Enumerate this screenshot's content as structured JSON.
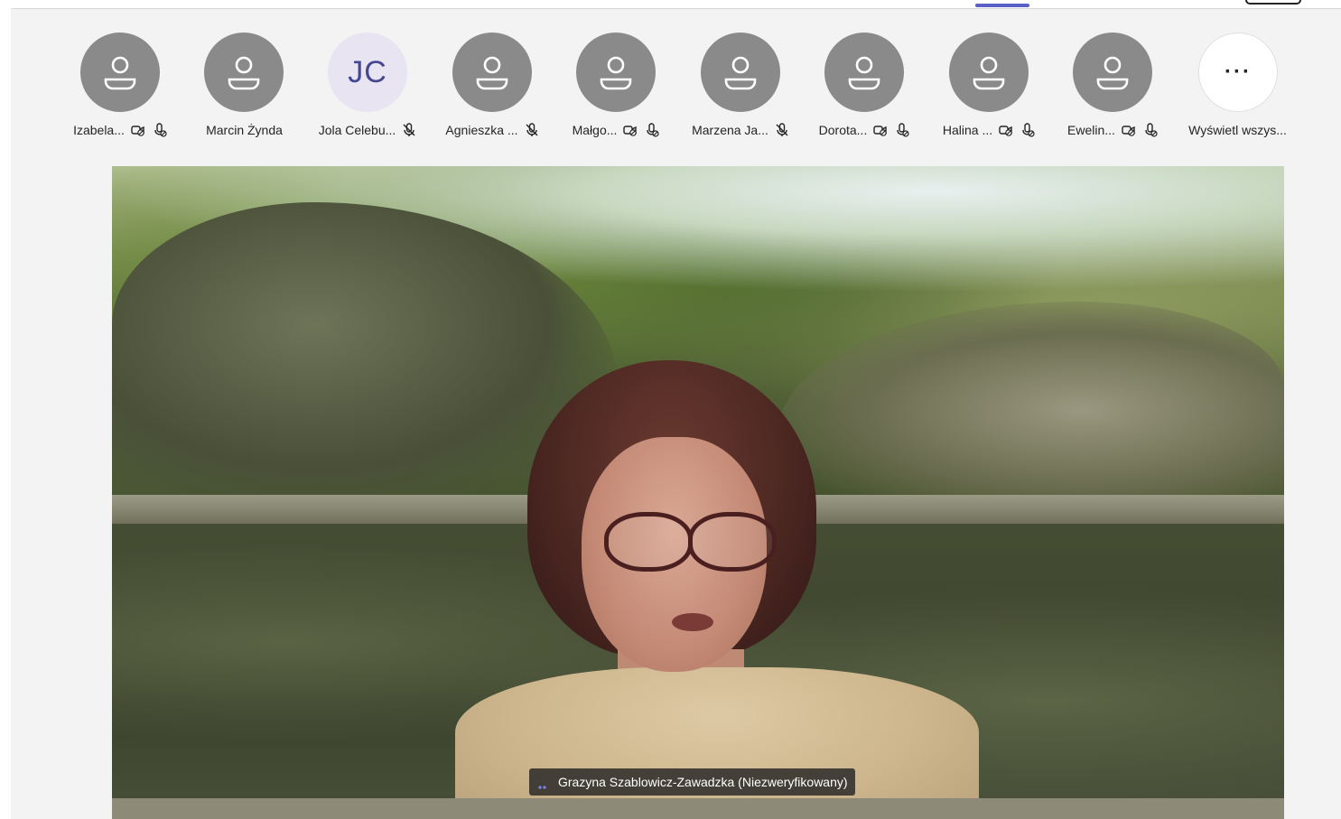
{
  "participants": [
    {
      "name": "Izabela...",
      "avatar": "person-icon",
      "camera_off": true,
      "mic": "mic-off-icon"
    },
    {
      "name": "Marcin Żynda",
      "avatar": "person-icon",
      "camera_off": false,
      "mic": null
    },
    {
      "name": "Jola Celebu...",
      "avatar_initials": "JC",
      "camera_off": false,
      "mic": "mic-muted-icon"
    },
    {
      "name": "Agnieszka ...",
      "avatar": "person-icon",
      "camera_off": false,
      "mic": "mic-muted-icon"
    },
    {
      "name": "Małgo...",
      "avatar": "person-icon",
      "camera_off": true,
      "mic": "mic-off-icon"
    },
    {
      "name": "Marzena Ja...",
      "avatar": "person-icon",
      "camera_off": false,
      "mic": "mic-muted-icon"
    },
    {
      "name": "Dorota...",
      "avatar": "person-icon",
      "camera_off": true,
      "mic": "mic-off-icon"
    },
    {
      "name": "Halina ...",
      "avatar": "person-icon",
      "camera_off": true,
      "mic": "mic-off-icon"
    },
    {
      "name": "Ewelin...",
      "avatar": "person-icon",
      "camera_off": true,
      "mic": "mic-off-icon"
    }
  ],
  "view_all": {
    "label": "Wyświetl wszys...",
    "icon": "more-icon",
    "glyph": "···"
  },
  "main_video": {
    "speaker_label": "Grazyna Szablowicz-Zawadzka (Niezweryfikowany)",
    "speaking_icon": "speaking-indicator-icon"
  },
  "colors": {
    "avatar_bg": "#8a8a8a",
    "initials_bg": "#e8e4f2",
    "initials_fg": "#444791",
    "accent": "#5b5fc7",
    "stage_bg": "#f3f3f3"
  }
}
